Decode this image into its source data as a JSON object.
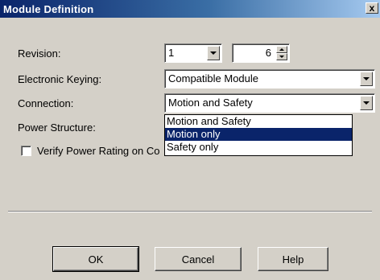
{
  "window": {
    "title": "Module Definition",
    "close_glyph": "x"
  },
  "revision": {
    "label": "Revision:",
    "major_value": "1",
    "minor_value": "6"
  },
  "electronic_keying": {
    "label": "Electronic Keying:",
    "value": "Compatible Module"
  },
  "connection": {
    "label": "Connection:",
    "value": "Motion and Safety",
    "options": [
      {
        "label": "Motion and Safety",
        "selected": false
      },
      {
        "label": "Motion only",
        "selected": true
      },
      {
        "label": "Safety only",
        "selected": false
      }
    ]
  },
  "power_structure": {
    "label": "Power Structure:"
  },
  "verify_power": {
    "label": "Verify Power Rating on Co",
    "checked": false
  },
  "buttons": {
    "ok": "OK",
    "cancel": "Cancel",
    "help": "Help"
  },
  "colors": {
    "title_bar_start": "#0a246a",
    "title_bar_end": "#a6caf0",
    "dialog_face": "#d4d0c8",
    "selection": "#0a246a"
  },
  "icons": {
    "dropdown": "chevron-down-icon",
    "spin_up": "chevron-up-icon",
    "spin_down": "chevron-down-icon"
  }
}
